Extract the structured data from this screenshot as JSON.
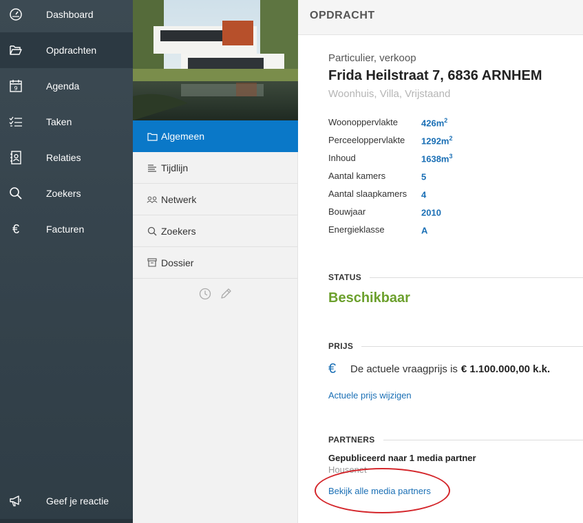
{
  "nav": {
    "items": [
      {
        "label": "Dashboard",
        "icon": "gauge-icon"
      },
      {
        "label": "Opdrachten",
        "icon": "folder-open-icon",
        "active": true
      },
      {
        "label": "Agenda",
        "icon": "calendar-icon",
        "calendar_day": "9"
      },
      {
        "label": "Taken",
        "icon": "checklist-icon"
      },
      {
        "label": "Relaties",
        "icon": "contact-book-icon"
      },
      {
        "label": "Zoekers",
        "icon": "search-icon"
      },
      {
        "label": "Facturen",
        "icon": "euro-icon",
        "glyph": "€"
      }
    ],
    "feedback": {
      "label": "Geef je reactie",
      "icon": "megaphone-icon"
    }
  },
  "subnav": {
    "items": [
      {
        "label": "Algemeen",
        "icon": "folder-icon",
        "active": true
      },
      {
        "label": "Tijdlijn",
        "icon": "lines-icon"
      },
      {
        "label": "Netwerk",
        "icon": "network-icon"
      },
      {
        "label": "Zoekers",
        "icon": "search-icon"
      },
      {
        "label": "Dossier",
        "icon": "archive-icon"
      }
    ],
    "actions": [
      "clock-icon",
      "pencil-icon"
    ]
  },
  "header": {
    "title": "OPDRACHT"
  },
  "property": {
    "type": "Particulier, verkoop",
    "address": "Frida Heilstraat 7, 6836 ARNHEM",
    "subtitle": "Woonhuis, Villa, Vrijstaand",
    "details": [
      {
        "key": "Woonoppervlakte",
        "value": "426m",
        "sup": "2"
      },
      {
        "key": "Perceeloppervlakte",
        "value": "1292m",
        "sup": "2"
      },
      {
        "key": "Inhoud",
        "value": "1638m",
        "sup": "3"
      },
      {
        "key": "Aantal kamers",
        "value": "5",
        "sup": ""
      },
      {
        "key": "Aantal slaapkamers",
        "value": "4",
        "sup": ""
      },
      {
        "key": "Bouwjaar",
        "value": "2010",
        "sup": ""
      },
      {
        "key": "Energieklasse",
        "value": "A",
        "sup": ""
      }
    ]
  },
  "status": {
    "heading": "STATUS",
    "value": "Beschikbaar"
  },
  "price": {
    "heading": "PRIJS",
    "euro_glyph": "€",
    "text": "De actuele vraagprijs is",
    "value": "€ 1.100.000,00 k.k.",
    "change_link": "Actuele prijs wijzigen"
  },
  "partners": {
    "heading": "PARTNERS",
    "published": "Gepubliceerd naar 1 media partner",
    "partner_name": "Housenet",
    "view_all_link": "Bekijk alle media partners"
  },
  "colors": {
    "nav_bg": "#3c4a53",
    "accent": "#0a78c8",
    "link": "#1a6fb5",
    "status_green": "#6ca02d",
    "annotation": "#d4262b"
  }
}
